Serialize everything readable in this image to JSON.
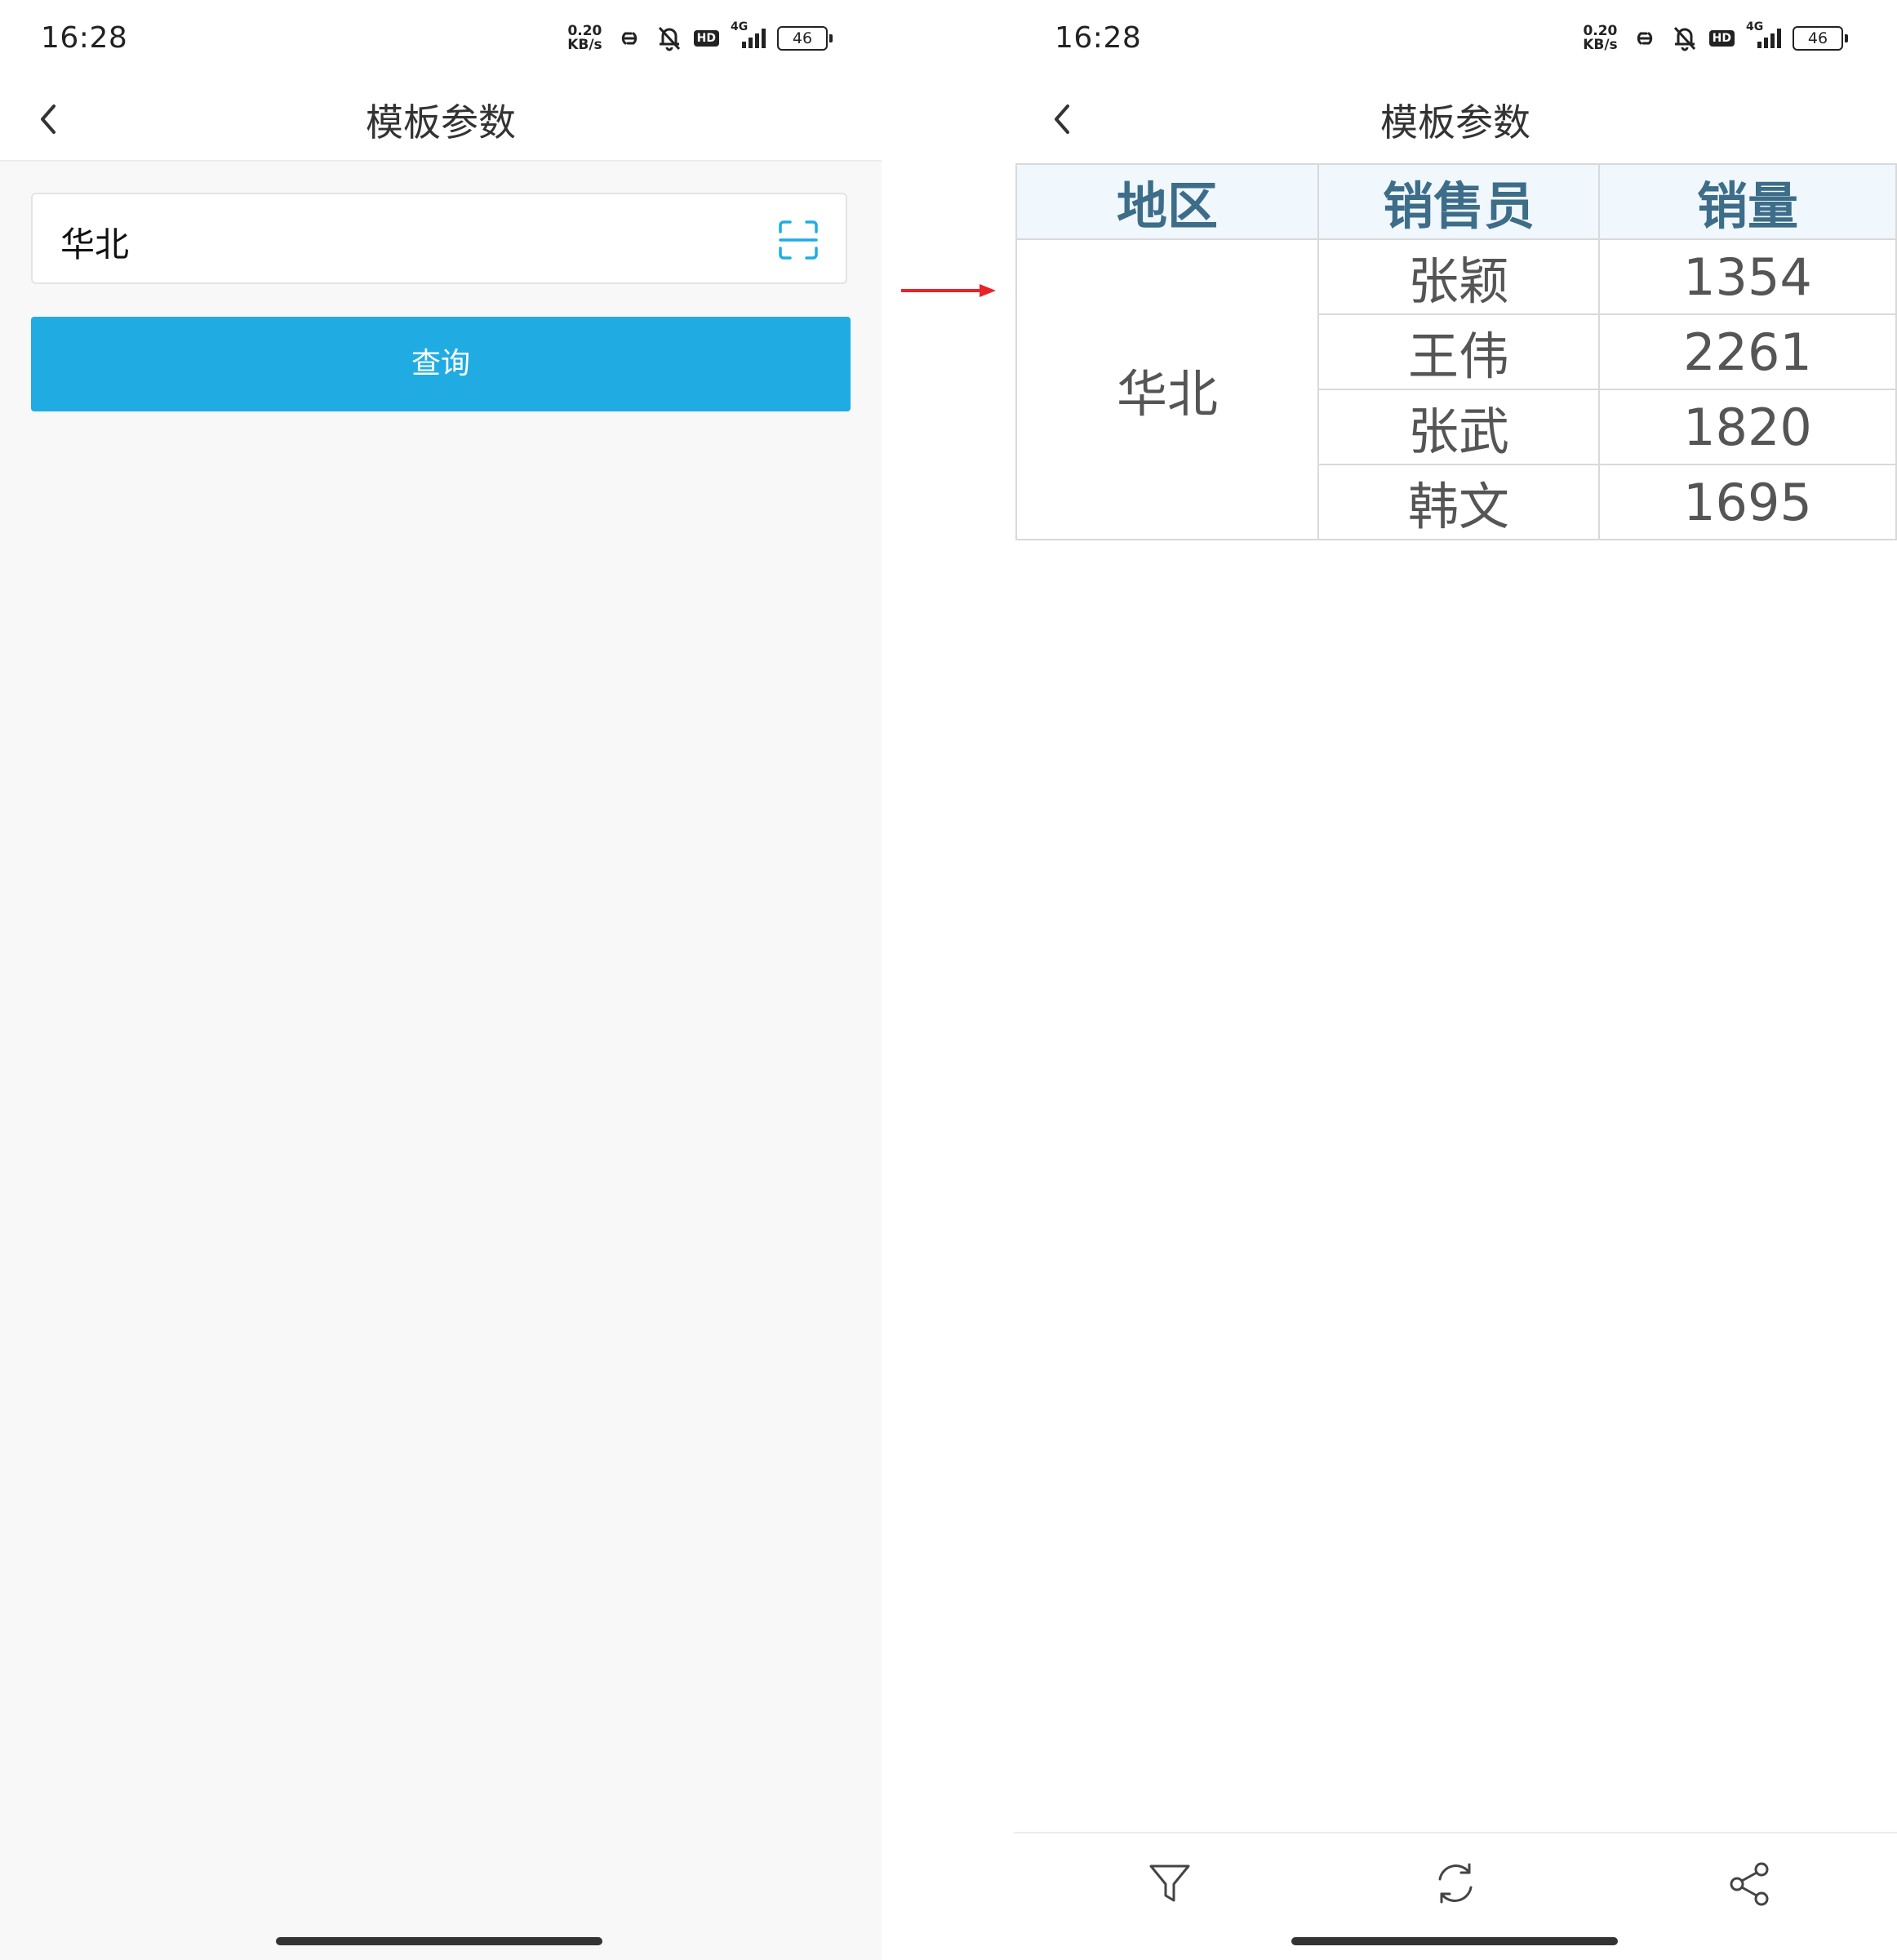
{
  "left_screen": {
    "status": {
      "time": "16:28",
      "net_speed_top": "0.20",
      "net_speed_bottom": "KB/s",
      "hd_label": "HD",
      "network_gen": "4G",
      "battery": "46"
    },
    "title": "模板参数",
    "param_input": {
      "value": "华北"
    },
    "query_button": "查询"
  },
  "right_screen": {
    "status": {
      "time": "16:28",
      "net_speed_top": "0.20",
      "net_speed_bottom": "KB/s",
      "hd_label": "HD",
      "network_gen": "4G",
      "battery": "46"
    },
    "title": "模板参数",
    "table": {
      "headers": [
        "地区",
        "销售员",
        "销量"
      ],
      "region": "华北",
      "rows": [
        {
          "salesperson": "张颖",
          "sales": "1354"
        },
        {
          "salesperson": "王伟",
          "sales": "2261"
        },
        {
          "salesperson": "张武",
          "sales": "1820"
        },
        {
          "salesperson": "韩文",
          "sales": "1695"
        }
      ]
    },
    "toolbar": [
      "filter-icon",
      "refresh-icon",
      "share-icon"
    ]
  },
  "colors": {
    "accent": "#20ace3",
    "table_header_bg": "#f0f7fd",
    "table_header_text": "#3d6d89",
    "arrow": "#e8232a"
  }
}
